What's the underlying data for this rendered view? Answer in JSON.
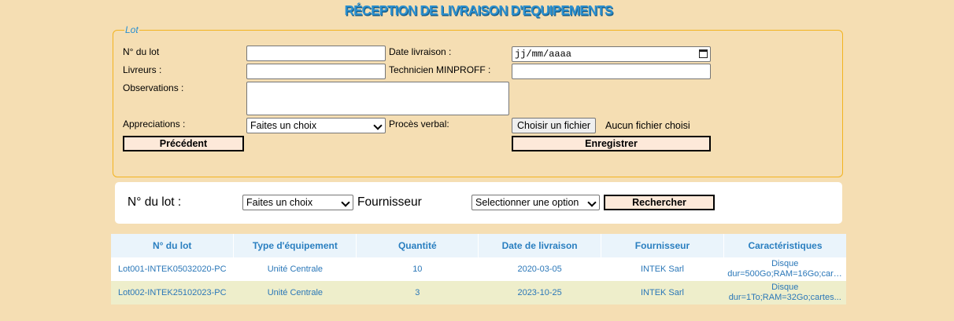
{
  "page": {
    "title": "RÉCEPTION DE LIVRAISON D'EQUIPEMENTS"
  },
  "lot_form": {
    "legend": "Lot",
    "lot_number_label": "N° du lot",
    "lot_number_value": "",
    "delivery_date_label": "Date livraison :",
    "delivery_date_placeholder": "jj/mm/aaaa",
    "deliverers_label": "Livreurs :",
    "deliverers_value": "",
    "technician_label": "Technicien MINPROFF :",
    "technician_value": "",
    "observations_label": "Observations :",
    "observations_value": "",
    "appreciations_label": "Appreciations :",
    "appreciations_selected": "Faites un choix",
    "minutes_label": "Procès verbal:",
    "file_button_label": "Choisir un fichier",
    "file_status": "Aucun fichier choisi",
    "previous_button": "Précédent",
    "save_button": "Enregistrer"
  },
  "search": {
    "lot_label": "N° du lot :",
    "lot_selected": "Faites un choix",
    "supplier_label": "Fournisseur",
    "supplier_selected": "Selectionner une option",
    "search_button": "Rechercher"
  },
  "table": {
    "headers": [
      "N° du lot",
      "Type d'équipement",
      "Quantité",
      "Date de livraison",
      "Fournisseur",
      "Caractéristiques"
    ],
    "rows": [
      {
        "lot": "Lot001-INTEK05032020-PC",
        "type": "Unité Centrale",
        "quantity": "10",
        "date": "2020-03-05",
        "supplier": "INTEK Sarl",
        "specs_line1": "Disque",
        "specs_line2": "dur=500Go;RAM=16Go;cart..."
      },
      {
        "lot": "Lot002-INTEK25102023-PC",
        "type": "Unité Centrale",
        "quantity": "3",
        "date": "2023-10-25",
        "supplier": "INTEK Sarl",
        "specs_line1": "Disque",
        "specs_line2": "dur=1To;RAM=32Go;cartes..."
      }
    ]
  },
  "colors": {
    "background": "#f5deb3",
    "title": "#2a8fcf",
    "fieldset_border": "#f2b320",
    "button_bg": "#fde9d9",
    "row_alt": "#eeeecb",
    "header_bg": "#eaf4fb"
  }
}
